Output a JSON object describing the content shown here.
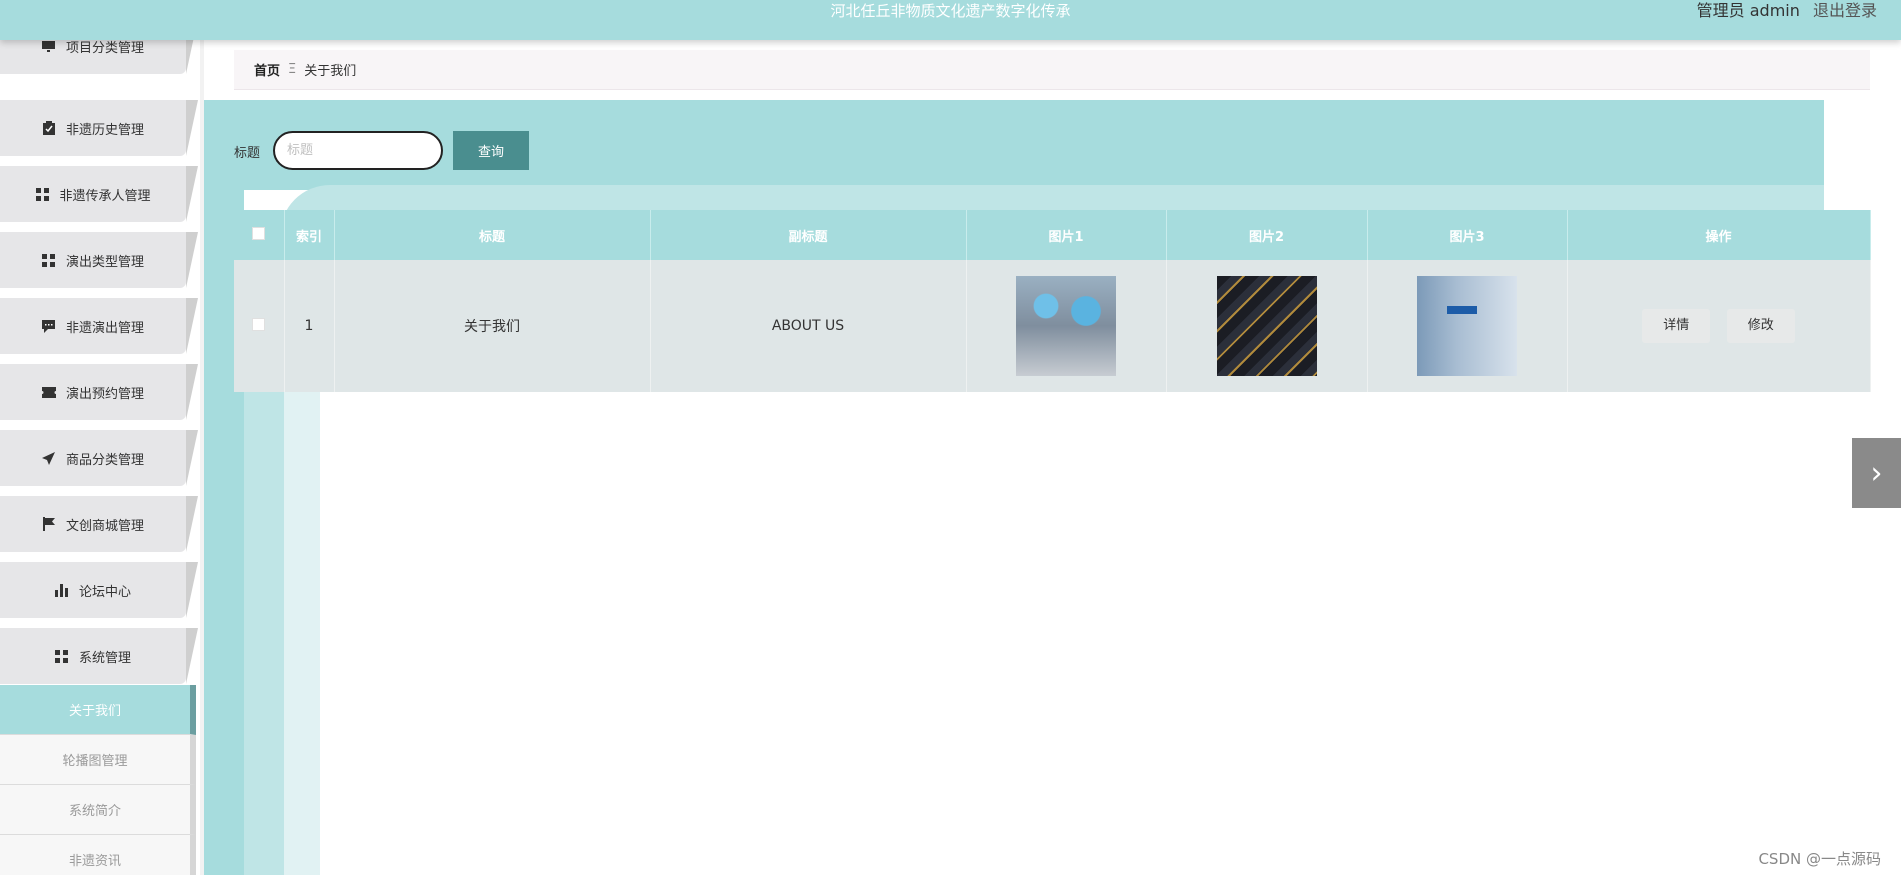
{
  "header": {
    "title": "河北任丘非物质文化遗产数字化传承",
    "user_text": "管理员 admin",
    "logout": "退出登录"
  },
  "sidebar": {
    "items": [
      {
        "label": "项目分类管理",
        "icon": "monitor-icon"
      },
      {
        "label": "非遗历史管理",
        "icon": "clipboard-icon"
      },
      {
        "label": "非遗传承人管理",
        "icon": "grid-icon"
      },
      {
        "label": "演出类型管理",
        "icon": "grid-icon"
      },
      {
        "label": "非遗演出管理",
        "icon": "chat-icon"
      },
      {
        "label": "演出预约管理",
        "icon": "ticket-icon"
      },
      {
        "label": "商品分类管理",
        "icon": "send-icon"
      },
      {
        "label": "文创商城管理",
        "icon": "flag-icon"
      },
      {
        "label": "论坛中心",
        "icon": "bar-chart-icon"
      },
      {
        "label": "系统管理",
        "icon": "grid-icon"
      }
    ],
    "sub_items": [
      {
        "label": "关于我们",
        "active": true
      },
      {
        "label": "轮播图管理",
        "active": false
      },
      {
        "label": "系统简介",
        "active": false
      },
      {
        "label": "非遗资讯",
        "active": false
      }
    ]
  },
  "breadcrumb": {
    "home": "首页",
    "separator": "Ξ",
    "current": "关于我们"
  },
  "search": {
    "label": "标题",
    "placeholder": "标题",
    "button": "查询"
  },
  "table": {
    "headers": [
      "索引",
      "标题",
      "副标题",
      "图片1",
      "图片2",
      "图片3",
      "操作"
    ],
    "rows": [
      {
        "index": "1",
        "title": "关于我们",
        "subtitle": "ABOUT US"
      }
    ],
    "actions": {
      "detail": "详情",
      "edit": "修改"
    }
  },
  "nav": {
    "next_icon": "chevron-right-icon",
    "next_glyph": "›"
  },
  "watermark": "CSDN @一点源码",
  "colors": {
    "accent": "#a6dcdd",
    "button": "#4a8e8f"
  }
}
